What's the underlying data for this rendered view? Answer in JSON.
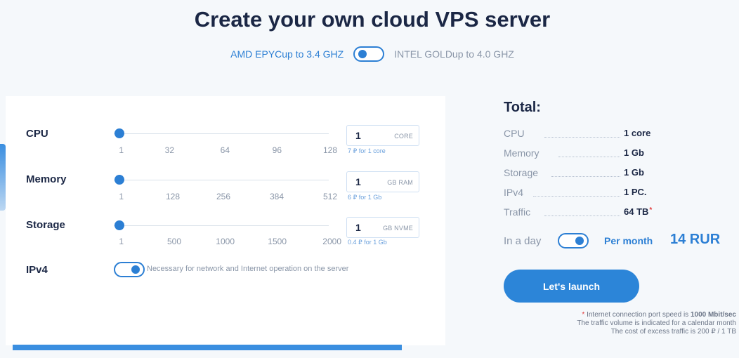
{
  "header": {
    "title": "Create your own cloud VPS server",
    "option_amd": "AMD EPYCup to 3.4 GHZ",
    "option_intel": "INTEL GOLDup to 4.0 GHZ",
    "selected": "AMD"
  },
  "config": {
    "cpu": {
      "label": "CPU",
      "ticks": [
        "1",
        "32",
        "64",
        "96",
        "128"
      ],
      "value": "1",
      "unit": "CORE",
      "price_note": "7 ₽ for 1 core",
      "slider_fraction": 0
    },
    "memory": {
      "label": "Memory",
      "ticks": [
        "1",
        "128",
        "256",
        "384",
        "512"
      ],
      "value": "1",
      "unit": "GB RAM",
      "price_note": "6 ₽ for 1 Gb",
      "slider_fraction": 0
    },
    "storage": {
      "label": "Storage",
      "ticks": [
        "1",
        "500",
        "1000",
        "1500",
        "2000"
      ],
      "value": "1",
      "unit": "GB NVME",
      "price_note": "0.4 ₽ for 1 Gb",
      "slider_fraction": 0
    },
    "ipv4": {
      "label": "IPv4",
      "note": "Necessary for network and Internet operation on the server",
      "enabled": true
    }
  },
  "total": {
    "title": "Total:",
    "rows": [
      {
        "key": "CPU",
        "value": "1 core"
      },
      {
        "key": "Memory",
        "value": "1 Gb"
      },
      {
        "key": "Storage",
        "value": "1 Gb"
      },
      {
        "key": "IPv4",
        "value": "1 PC."
      },
      {
        "key": "Traffic",
        "value": "64 TB"
      }
    ],
    "traffic_marker": "*",
    "period_day": "In a day",
    "period_month": "Per month",
    "price": "14 RUR",
    "launch_label": "Let's launch"
  },
  "footnotes": {
    "marker": "*",
    "line1_prefix": " Internet connection port speed is ",
    "line1_bold": "1000 Mbit/sec",
    "line2": "The traffic volume is indicated for a calendar month",
    "line3": "The cost of excess traffic is 200 ₽ / 1 TB"
  },
  "colors": {
    "accent": "#2c7fd4",
    "title": "#1b2745",
    "muted": "#8a96a8"
  }
}
